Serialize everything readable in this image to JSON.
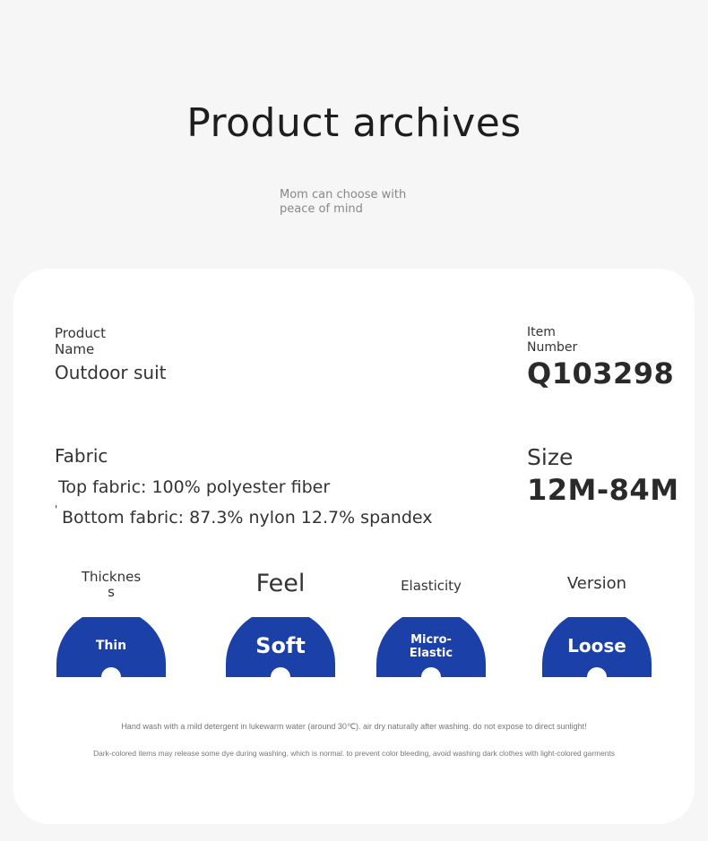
{
  "header": {
    "title": "Product archives",
    "subtitle": "Mom can choose with peace of mind"
  },
  "product": {
    "name_label": "Product Name",
    "name_value": "Outdoor suit",
    "item_label": "Item Number",
    "item_value": "Q103298",
    "fabric_label": "Fabric",
    "fabric_top": "Top fabric: 100% polyester fiber",
    "fabric_bottom": "Bottom fabric: 87.3% nylon 12.7% spandex",
    "size_label": "Size",
    "size_value": "12M-84M"
  },
  "attributes": [
    {
      "label": "Thickness",
      "value": "Thin"
    },
    {
      "label": "Feel",
      "value": "Soft"
    },
    {
      "label": "Elasticity",
      "value": "Micro-Elastic"
    },
    {
      "label": "Version",
      "value": "Loose"
    }
  ],
  "notes": {
    "wash": "Hand wash with a mild detergent in lukewarm water (around 30℃). air dry naturally after washing. do not expose to direct sunlight!",
    "dye": "Dark-colored items may release some dye during washing, which is normal. to prevent color bleeding, avoid washing dark clothes with light-colored garments"
  },
  "colors": {
    "badge": "#1b40a8",
    "background": "#f6f6f6",
    "card": "#ffffff"
  }
}
